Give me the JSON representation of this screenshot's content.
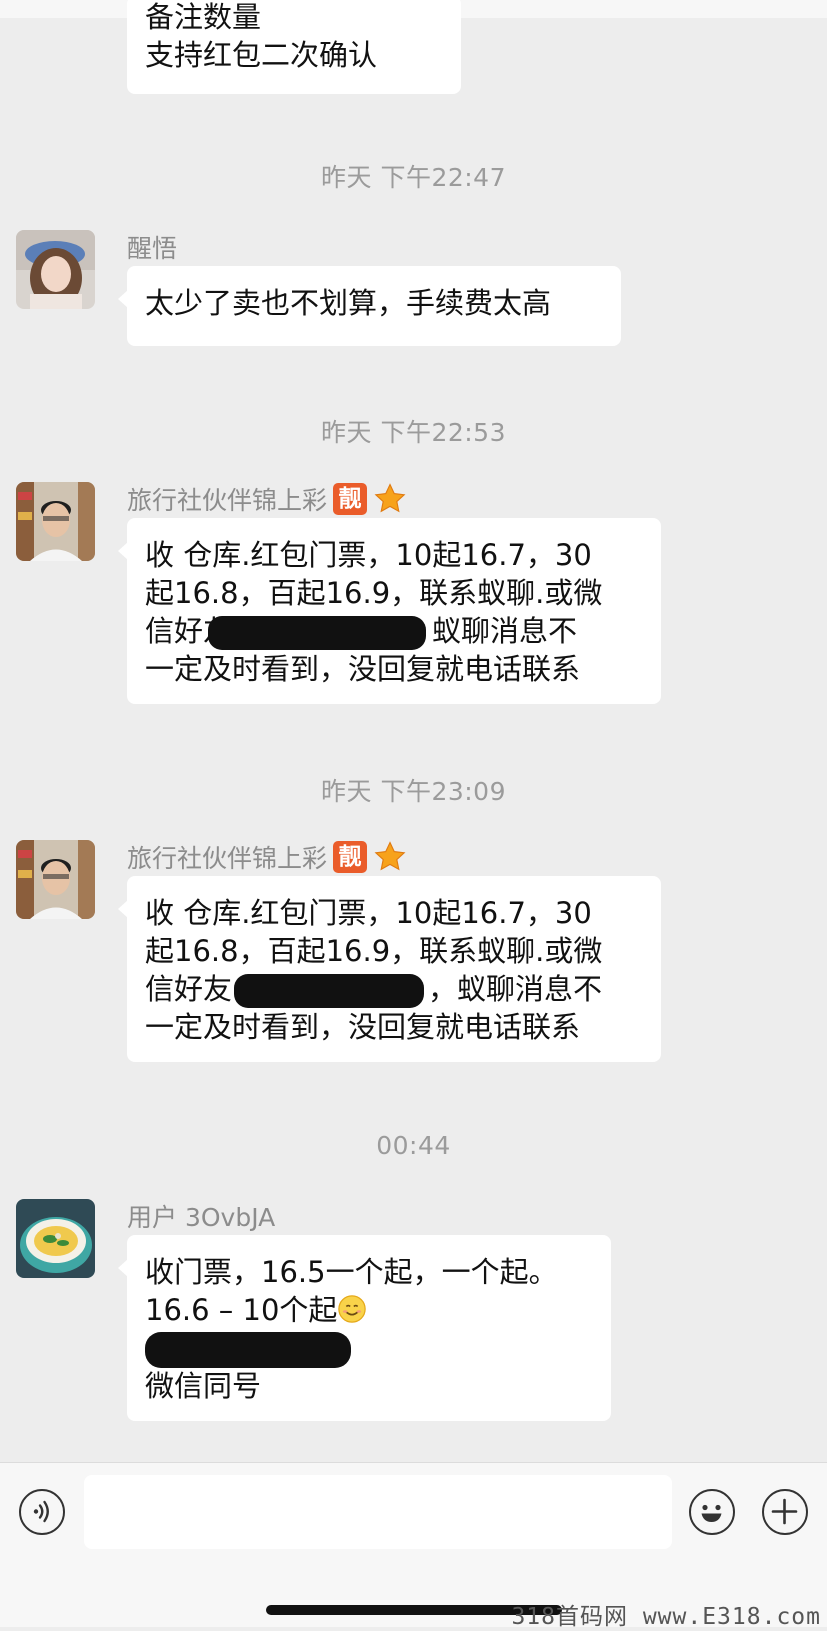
{
  "messages": [
    {
      "lines": [
        "备注数量",
        "支持红包二次确认"
      ]
    },
    {
      "timestamp": "昨天 下午22:47",
      "sender": "醒悟",
      "lines": [
        "太少了卖也不划算，手续费太高"
      ]
    },
    {
      "timestamp": "昨天 下午22:53",
      "sender": "旅行社伙伴锦上彩",
      "badge": "靓",
      "lines": [
        "收 仓库.红包门票，10起16.7，30",
        "起16.8，百起16.9，联系蚁聊.或微",
        "信好友",
        "蚁聊消息不",
        "一定及时看到，没回复就电话联系"
      ]
    },
    {
      "timestamp": "昨天 下午23:09",
      "sender": "旅行社伙伴锦上彩",
      "badge": "靓",
      "lines": [
        "收 仓库.红包门票，10起16.7，30",
        "起16.8，百起16.9，联系蚁聊.或微",
        "信好友",
        "，蚁聊消息不",
        "一定及时看到，没回复就电话联系"
      ]
    },
    {
      "timestamp": "00:44",
      "sender": "用户 3OvbJA",
      "lines": [
        "收门票，16.5一个起，一个起。",
        "16.6 – 10个起",
        "微信同号"
      ]
    }
  ],
  "icons": {
    "voice": "voice-icon",
    "emoji": "emoji-icon",
    "add": "plus-icon",
    "badge_star": "star-icon",
    "inline_emoji": "smile-icon"
  },
  "colors": {
    "background": "#ededed",
    "bubble": "#ffffff",
    "timestamp": "#9b9b9b",
    "badge": "#ea5c2a"
  },
  "watermark": "318首码网 www.E318.com"
}
